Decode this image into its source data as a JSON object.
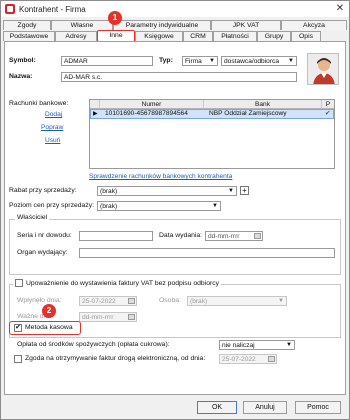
{
  "window": {
    "title": "Kontrahent - Firma",
    "close_glyph": "✕"
  },
  "tabs_top": [
    {
      "label": "Zgody"
    },
    {
      "label": "Własne"
    },
    {
      "label": "Parametry indywidualne"
    },
    {
      "label": "JPK VAT"
    },
    {
      "label": "Akcyza"
    }
  ],
  "tabs_bottom": [
    {
      "label": "Podstawowe"
    },
    {
      "label": "Adresy"
    },
    {
      "label": "Inne"
    },
    {
      "label": "Księgowe"
    },
    {
      "label": "CRM"
    },
    {
      "label": "Płatności"
    },
    {
      "label": "Grupy"
    },
    {
      "label": "Opis"
    }
  ],
  "annotations": {
    "badge1": "1",
    "badge2": "2"
  },
  "form": {
    "symbol_label": "Symbol:",
    "symbol_value": "ADMAR",
    "typ_label": "Typ:",
    "typ_value": "Firma",
    "typ2_value": "dostawca/odbiorca",
    "nazwa_label": "Nazwa:",
    "nazwa_value": "AD-MAR s.c."
  },
  "bank": {
    "section_label": "Rachunki bankowe:",
    "actions": [
      "Dodaj",
      "Popraw",
      "Usuń"
    ],
    "columns": [
      "Numer",
      "Bank",
      "P"
    ],
    "rows": [
      {
        "numer": "10101690-45678987894564",
        "bank": "NBP Oddział Zamiejscowy",
        "p": "✔"
      }
    ],
    "verify_link": "Sprawdzenie rachunków bankowych kontrahenta"
  },
  "rabat": {
    "label": "Rabat przy sprzedaży:",
    "value": "(brak)",
    "plus": "+"
  },
  "poziom": {
    "label": "Poziom cen przy sprzedaży:",
    "value": "(brak)"
  },
  "wlasciciel": {
    "title": "Właściciel",
    "seria_label": "Seria i nr dowodu:",
    "seria_value": "",
    "data_label": "Data wydania:",
    "data_value": "dd-mm-rrrr",
    "organ_label": "Organ wydający:",
    "organ_value": ""
  },
  "upowaznienie": {
    "label": "Upoważnienie do wystawienia faktury VAT bez podpisu odbiorcy",
    "wplynelo_label": "Wpłynęło dnia:",
    "wplynelo_value": "25-07-2022",
    "osoba_label": "Osoba:",
    "osoba_value": "(brak)",
    "wazne_label": "Ważne do:",
    "wazne_value": "dd-mm-rrrr"
  },
  "metoda": {
    "label": "Metoda kasowa",
    "checked": "✔"
  },
  "oplata": {
    "label": "Opłata od środków spożywczych (opłata cukrowa):",
    "value": "nie naliczaj"
  },
  "zgoda": {
    "label": "Zgoda na otrzymywanie faktur drogą elektroniczną, od dnia:",
    "value": "25-07-2022"
  },
  "buttons": {
    "ok": "OK",
    "anuluj": "Anuluj",
    "pomoc": "Pomoc"
  },
  "colors": {
    "accent": "#e4322b",
    "selection": "#cfe3fb",
    "link": "#1a5fb4"
  }
}
